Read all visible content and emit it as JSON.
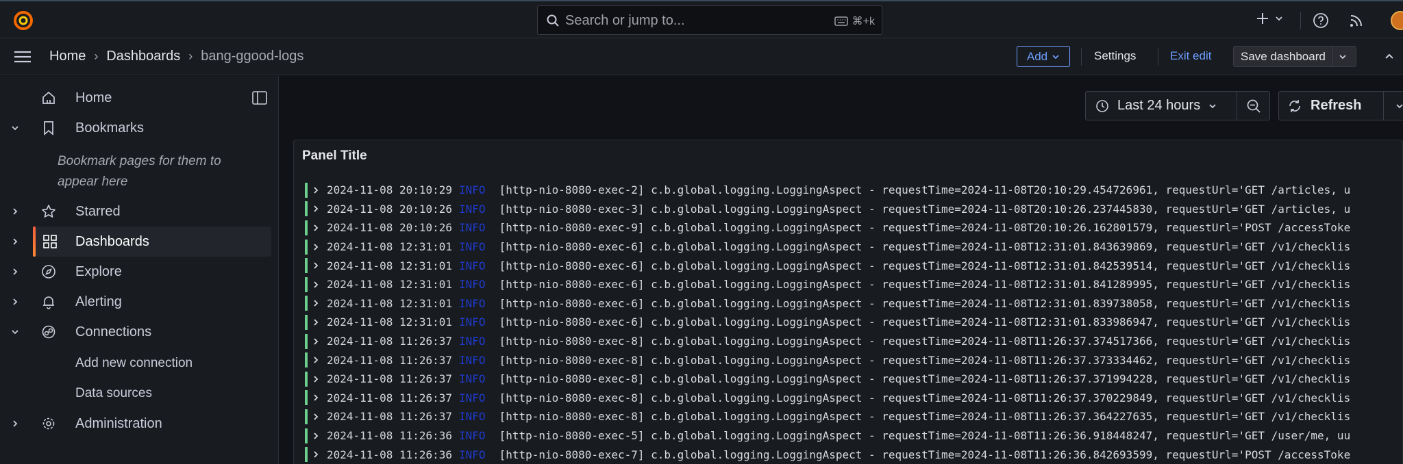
{
  "topbar": {
    "search_placeholder": "Search or jump to...",
    "search_shortcut": "⌘+k"
  },
  "breadcrumb": {
    "home": "Home",
    "dashboards": "Dashboards",
    "current": "bang-ggood-logs"
  },
  "toolbar": {
    "add_label": "Add",
    "settings_label": "Settings",
    "exit_edit_label": "Exit edit",
    "save_label": "Save dashboard"
  },
  "sidebar": {
    "items": [
      {
        "label": "Home"
      },
      {
        "label": "Bookmarks"
      },
      {
        "label": "Starred"
      },
      {
        "label": "Dashboards"
      },
      {
        "label": "Explore"
      },
      {
        "label": "Alerting"
      },
      {
        "label": "Connections"
      },
      {
        "label": "Administration"
      }
    ],
    "bookmarks_hint": "Bookmark pages for them to appear here",
    "connections_children": [
      "Add new connection",
      "Data sources"
    ]
  },
  "controls": {
    "time_range": "Last 24 hours",
    "refresh_label": "Refresh"
  },
  "panel": {
    "title": "Panel Title",
    "logs": [
      {
        "ts": "2024-11-08 20:10:29",
        "level": "INFO",
        "msg": "[http-nio-8080-exec-2] c.b.global.logging.LoggingAspect - requestTime=2024-11-08T20:10:29.454726961, requestUrl='GET /articles, u"
      },
      {
        "ts": "2024-11-08 20:10:26",
        "level": "INFO",
        "msg": "[http-nio-8080-exec-3] c.b.global.logging.LoggingAspect - requestTime=2024-11-08T20:10:26.237445830, requestUrl='GET /articles, u"
      },
      {
        "ts": "2024-11-08 20:10:26",
        "level": "INFO",
        "msg": "[http-nio-8080-exec-9] c.b.global.logging.LoggingAspect - requestTime=2024-11-08T20:10:26.162801579, requestUrl='POST /accessToke"
      },
      {
        "ts": "2024-11-08 12:31:01",
        "level": "INFO",
        "msg": "[http-nio-8080-exec-6] c.b.global.logging.LoggingAspect - requestTime=2024-11-08T12:31:01.843639869, requestUrl='GET /v1/checklis"
      },
      {
        "ts": "2024-11-08 12:31:01",
        "level": "INFO",
        "msg": "[http-nio-8080-exec-6] c.b.global.logging.LoggingAspect - requestTime=2024-11-08T12:31:01.842539514, requestUrl='GET /v1/checklis"
      },
      {
        "ts": "2024-11-08 12:31:01",
        "level": "INFO",
        "msg": "[http-nio-8080-exec-6] c.b.global.logging.LoggingAspect - requestTime=2024-11-08T12:31:01.841289995, requestUrl='GET /v1/checklis"
      },
      {
        "ts": "2024-11-08 12:31:01",
        "level": "INFO",
        "msg": "[http-nio-8080-exec-6] c.b.global.logging.LoggingAspect - requestTime=2024-11-08T12:31:01.839738058, requestUrl='GET /v1/checklis"
      },
      {
        "ts": "2024-11-08 12:31:01",
        "level": "INFO",
        "msg": "[http-nio-8080-exec-6] c.b.global.logging.LoggingAspect - requestTime=2024-11-08T12:31:01.833986947, requestUrl='GET /v1/checklis"
      },
      {
        "ts": "2024-11-08 11:26:37",
        "level": "INFO",
        "msg": "[http-nio-8080-exec-8] c.b.global.logging.LoggingAspect - requestTime=2024-11-08T11:26:37.374517366, requestUrl='GET /v1/checklis"
      },
      {
        "ts": "2024-11-08 11:26:37",
        "level": "INFO",
        "msg": "[http-nio-8080-exec-8] c.b.global.logging.LoggingAspect - requestTime=2024-11-08T11:26:37.373334462, requestUrl='GET /v1/checklis"
      },
      {
        "ts": "2024-11-08 11:26:37",
        "level": "INFO",
        "msg": "[http-nio-8080-exec-8] c.b.global.logging.LoggingAspect - requestTime=2024-11-08T11:26:37.371994228, requestUrl='GET /v1/checklis"
      },
      {
        "ts": "2024-11-08 11:26:37",
        "level": "INFO",
        "msg": "[http-nio-8080-exec-8] c.b.global.logging.LoggingAspect - requestTime=2024-11-08T11:26:37.370229849, requestUrl='GET /v1/checklis"
      },
      {
        "ts": "2024-11-08 11:26:37",
        "level": "INFO",
        "msg": "[http-nio-8080-exec-8] c.b.global.logging.LoggingAspect - requestTime=2024-11-08T11:26:37.364227635, requestUrl='GET /v1/checklis"
      },
      {
        "ts": "2024-11-08 11:26:36",
        "level": "INFO",
        "msg": "[http-nio-8080-exec-5] c.b.global.logging.LoggingAspect - requestTime=2024-11-08T11:26:36.918448247, requestUrl='GET /user/me, uu"
      },
      {
        "ts": "2024-11-08 11:26:36",
        "level": "INFO",
        "msg": "[http-nio-8080-exec-7] c.b.global.logging.LoggingAspect - requestTime=2024-11-08T11:26:36.842693599, requestUrl='POST /accessToke"
      }
    ]
  },
  "colors": {
    "accent_blue": "#6e9fff",
    "log_level_info": "#1f3bd0",
    "log_bar": "#6ccf8e",
    "active_indicator": "#f55f3e"
  }
}
